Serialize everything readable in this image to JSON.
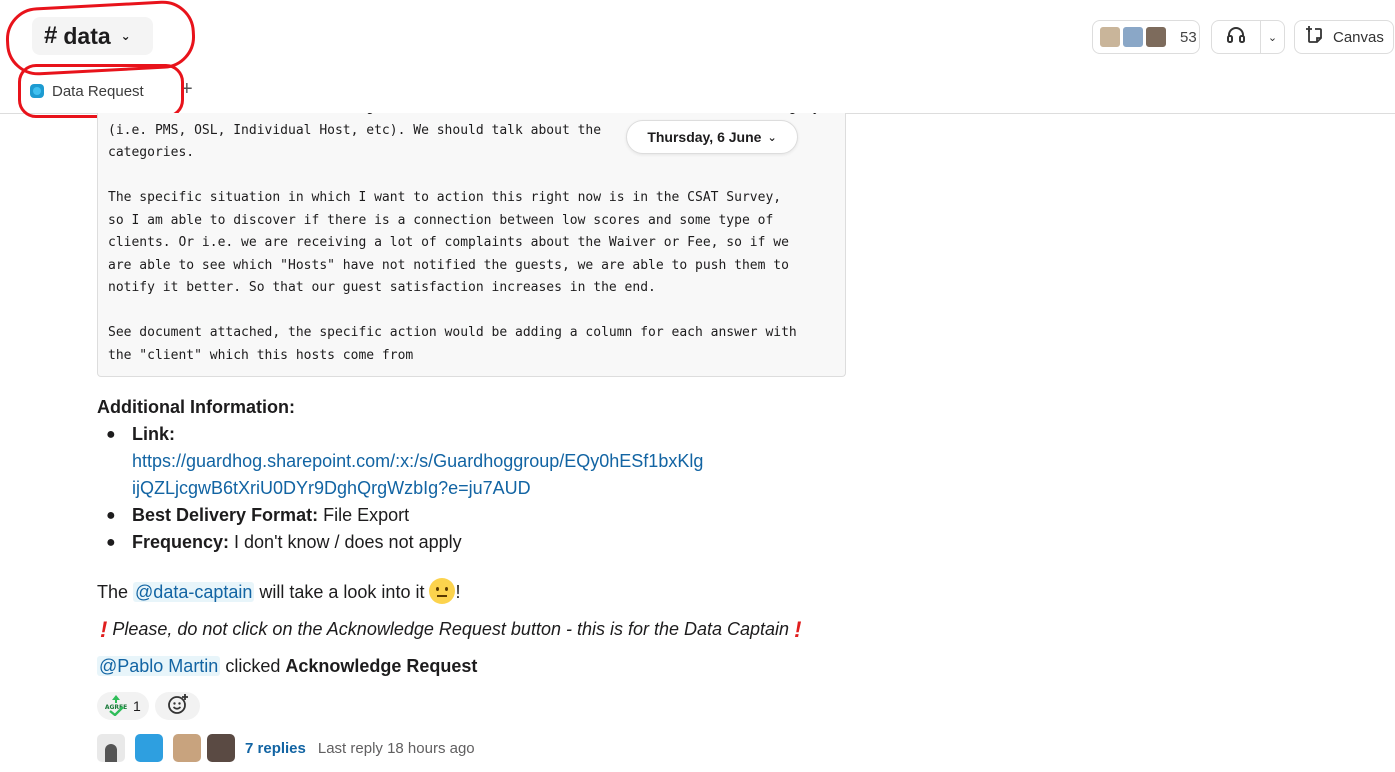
{
  "header": {
    "channel_hash": "#",
    "channel_name": "data",
    "member_count": "53",
    "canvas_label": "Canvas"
  },
  "tabs": {
    "active_tab": "Data Request",
    "add_tab": "+"
  },
  "date_divider": "Thursday, 6 June",
  "code_lines": [
    "It would be useful to have bookings classified for client and therefore for client category",
    "(i.e. PMS, OSL, Individual Host, etc). We should talk about the",
    "categories.",
    "",
    "The specific situation in which I want to action this right now is in the CSAT Survey,",
    "so I am able to discover if there is a connection between low scores and some type of",
    "clients. Or i.e. we are receiving a lot of complaints about the Waiver or Fee, so if we",
    "are able to see which \"Hosts\" have not notified the guests, we are able to push them to",
    "notify it better. So that our guest satisfaction increases in the end.",
    "",
    "See document attached, the specific action would be adding a column for each answer with",
    "the \"client\" which this hosts come from"
  ],
  "additional_info": {
    "heading": "Additional Information:",
    "link_label": "Link:",
    "link_url": "https://guardhog.sharepoint.com/:x:/s/Guardhoggroup/EQy0hESf1bxKlgijQZLjcgwB6tXriU0DYr9DghQrgWzbIg?e=ju7AUD",
    "format_label": "Best Delivery Format:",
    "format_value": " File Export",
    "frequency_label": "Frequency:",
    "frequency_value": " I don't know / does not apply"
  },
  "captain_line": {
    "prefix": "The ",
    "mention": "@data-captain",
    "suffix": " will take a look into it ",
    "end": "!"
  },
  "warning_line": "Please, do not click on the Acknowledge Request button - this is for the Data Captain",
  "ack_line": {
    "mention": "@Pablo Martin",
    "middle": " clicked ",
    "action": "Acknowledge Request"
  },
  "reactions": [
    {
      "icon": "agree-icon",
      "count": "1"
    }
  ],
  "thread": {
    "replies": "7 replies",
    "last_reply": "Last reply 18 hours ago"
  },
  "colors": {
    "link": "#1264a3",
    "annotation": "#e8131b"
  }
}
